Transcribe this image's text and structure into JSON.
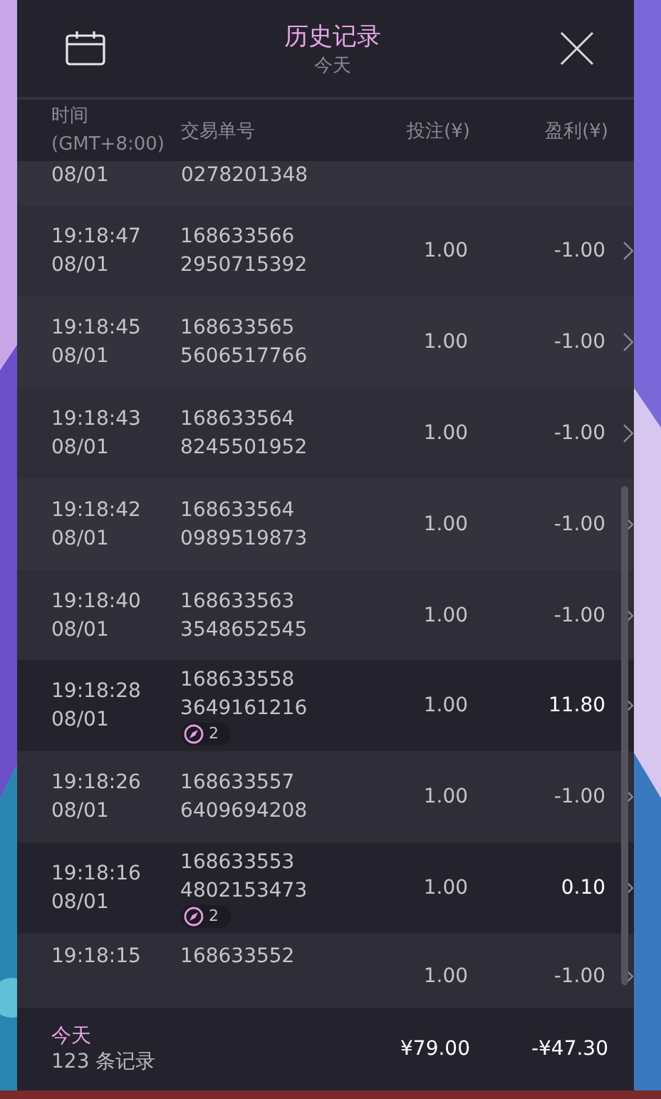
{
  "header": {
    "title": "历史记录",
    "subtitle": "今天"
  },
  "columns": [
    {
      "label": "时间",
      "sub": "(GMT+8:00)"
    },
    {
      "label": "交易单号"
    },
    {
      "label": "投注(¥)"
    },
    {
      "label": "盈利(¥)"
    }
  ],
  "rows": [
    {
      "kind": "clipped_top",
      "date": "08/01",
      "order": [
        "0278201348"
      ]
    },
    {
      "kind": "full",
      "time": "19:18:47",
      "date": "08/01",
      "order": [
        "168633566",
        "2950715392"
      ],
      "bet": "1.00",
      "profit": "-1.00",
      "win": false
    },
    {
      "kind": "full",
      "time": "19:18:45",
      "date": "08/01",
      "order": [
        "168633565",
        "5606517766"
      ],
      "bet": "1.00",
      "profit": "-1.00",
      "win": false
    },
    {
      "kind": "full",
      "time": "19:18:43",
      "date": "08/01",
      "order": [
        "168633564",
        "8245501952"
      ],
      "bet": "1.00",
      "profit": "-1.00",
      "win": false
    },
    {
      "kind": "full",
      "time": "19:18:42",
      "date": "08/01",
      "order": [
        "168633564",
        "0989519873"
      ],
      "bet": "1.00",
      "profit": "-1.00",
      "win": false
    },
    {
      "kind": "full",
      "time": "19:18:40",
      "date": "08/01",
      "order": [
        "168633563",
        "3548652545"
      ],
      "bet": "1.00",
      "profit": "-1.00",
      "win": false
    },
    {
      "kind": "full",
      "time": "19:18:28",
      "date": "08/01",
      "order": [
        "168633558",
        "3649161216"
      ],
      "badge": "2",
      "bet": "1.00",
      "profit": "11.80",
      "win": true
    },
    {
      "kind": "full",
      "time": "19:18:26",
      "date": "08/01",
      "order": [
        "168633557",
        "6409694208"
      ],
      "bet": "1.00",
      "profit": "-1.00",
      "win": false
    },
    {
      "kind": "full",
      "time": "19:18:16",
      "date": "08/01",
      "order": [
        "168633553",
        "4802153473"
      ],
      "badge": "2",
      "bet": "1.00",
      "profit": "0.10",
      "win": true
    },
    {
      "kind": "clipped_bottom",
      "time": "19:18:15",
      "order": [
        "168633552"
      ],
      "bet": "1.00",
      "profit": "-1.00",
      "win": false
    }
  ],
  "footer": {
    "period": "今天",
    "count": "123 条记录",
    "bet_total": "¥79.00",
    "profit_total": "-¥47.30"
  }
}
